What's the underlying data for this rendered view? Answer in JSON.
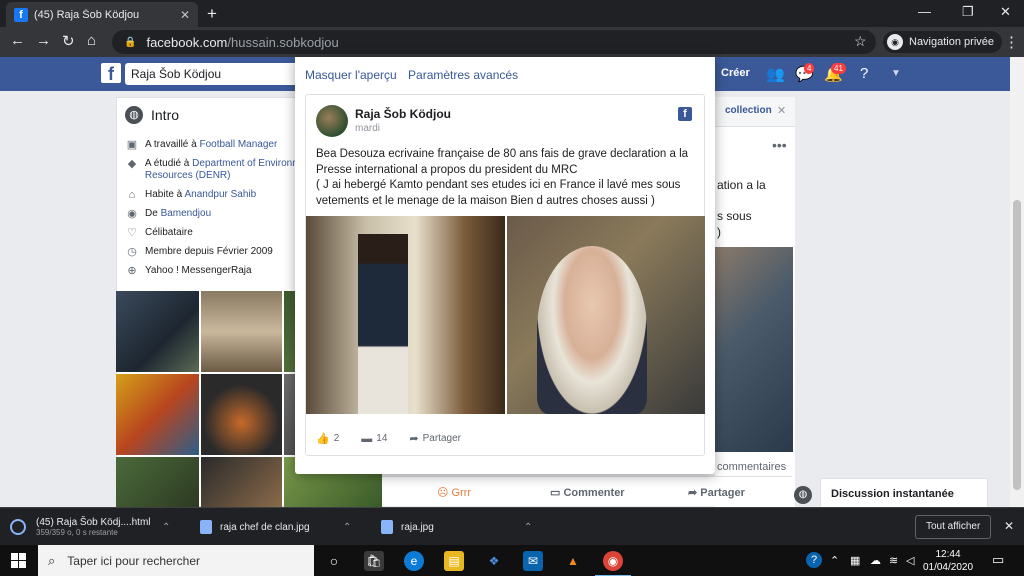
{
  "browser": {
    "tab_title": "(45) Raja Šob Ködjou",
    "url_host": "facebook.com",
    "url_path": "/hussain.sobkodjou",
    "incognito_label": "Navigation privée"
  },
  "fb": {
    "search_value": "Raja Šob Ködjou",
    "create_label": "Créer",
    "messages_badge": "4",
    "notifications_badge": "41"
  },
  "intro": {
    "title": "Intro",
    "rows": [
      {
        "prefix": "A travaillé à ",
        "link": "Football Manager"
      },
      {
        "prefix": "A étudié à ",
        "link": "Department of Environment and Natural Resources (DENR)"
      },
      {
        "prefix": "Habite à ",
        "link": "Anandpur Sahib"
      },
      {
        "prefix": "De ",
        "link": "Bamendjou"
      },
      {
        "prefix": "Célibataire",
        "link": ""
      },
      {
        "prefix": "Membre depuis Février 2009",
        "link": ""
      },
      {
        "prefix": "Yahoo ! MessengerRaja",
        "link": ""
      }
    ]
  },
  "background": {
    "collection": "collection",
    "text1": "ation a la",
    "text2": "s sous",
    "text3": ")",
    "comments": "commentaires",
    "grrr": "Grrr",
    "comment_btn": "Commenter",
    "share_btn": "Partager",
    "chat_label": "Discussion instantanée"
  },
  "modal": {
    "hide_preview": "Masquer l'aperçu",
    "advanced": "Paramètres avancés",
    "post": {
      "author": "Raja Šob Ködjou",
      "date": "mardi",
      "text_line1": "Bea Desouza ecrivaine française de 80 ans fais de grave declaration a la",
      "text_line2": "Presse international a propos du president du MRC",
      "text_line3": "( J ai hebergé Kamto pendant ses etudes ici en France il lavé mes sous",
      "text_line4": "vetements et le menage de la maison Bien d autres choses aussi )",
      "likes": "2",
      "comments": "14",
      "share_label": "Partager"
    }
  },
  "downloads": [
    {
      "name": "(45) Raja Šob Ködj....html",
      "sub": "359/359 o, 0 s restante"
    },
    {
      "name": "raja chef de clan.jpg",
      "sub": ""
    },
    {
      "name": "raja.jpg",
      "sub": ""
    }
  ],
  "downloads_show_all": "Tout afficher",
  "taskbar": {
    "search_placeholder": "Taper ici pour rechercher",
    "time": "12:44",
    "date": "01/04/2020"
  },
  "colors": {
    "fb_blue": "#3b5998",
    "link": "#385898",
    "chrome_dark": "#202124"
  }
}
